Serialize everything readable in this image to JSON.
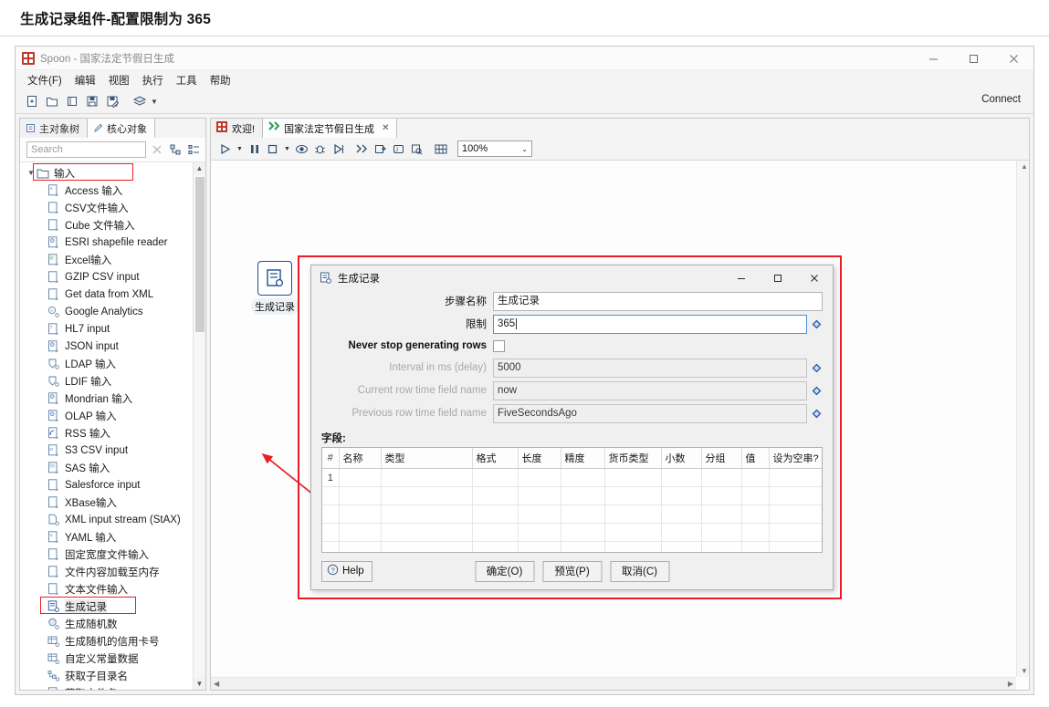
{
  "page": {
    "header_title": "生成记录组件-配置限制为 365"
  },
  "app": {
    "window_title": "Spoon - 国家法定节假日生成",
    "app_icon": "spoon-icon",
    "window_controls": [
      "minimize",
      "maximize",
      "close"
    ],
    "menus": [
      "文件(F)",
      "编辑",
      "视图",
      "执行",
      "工具",
      "帮助"
    ],
    "toolbar_icons": [
      "new-file-icon",
      "open-folder-icon",
      "explorer-icon",
      "save-icon",
      "save-as-icon",
      "layers-icon",
      "dropdown-caret-icon"
    ],
    "connect_label": "Connect"
  },
  "sidebar": {
    "tabs": [
      {
        "label": "主对象树",
        "icon": "tree-icon",
        "active": false
      },
      {
        "label": "核心对象",
        "icon": "pencil-icon",
        "active": true
      }
    ],
    "search": {
      "placeholder": "Search",
      "value": "",
      "clear_icon": "clear-x-icon",
      "expand_icon": "expand-all-icon",
      "collapse_icon": "collapse-all-icon"
    },
    "tree": {
      "root": {
        "label": "输入",
        "icon": "folder-icon",
        "expanded": true,
        "highlighted": true
      },
      "items": [
        {
          "label": "Access 输入",
          "icon": "access-input-icon"
        },
        {
          "label": "CSV文件输入",
          "icon": "csv-input-icon"
        },
        {
          "label": "Cube 文件输入",
          "icon": "cube-input-icon"
        },
        {
          "label": "ESRI shapefile reader",
          "icon": "esri-input-icon"
        },
        {
          "label": "Excel输入",
          "icon": "excel-input-icon"
        },
        {
          "label": "GZIP CSV input",
          "icon": "gzip-csv-icon"
        },
        {
          "label": "Get data from XML",
          "icon": "xml-input-icon"
        },
        {
          "label": "Google Analytics",
          "icon": "google-analytics-icon"
        },
        {
          "label": "HL7 input",
          "icon": "hl7-input-icon"
        },
        {
          "label": "JSON input",
          "icon": "json-input-icon"
        },
        {
          "label": "LDAP 输入",
          "icon": "ldap-input-icon"
        },
        {
          "label": "LDIF 输入",
          "icon": "ldif-input-icon"
        },
        {
          "label": "Mondrian 输入",
          "icon": "mondrian-input-icon"
        },
        {
          "label": "OLAP 输入",
          "icon": "olap-input-icon"
        },
        {
          "label": "RSS 输入",
          "icon": "rss-input-icon"
        },
        {
          "label": "S3 CSV input",
          "icon": "s3-csv-icon"
        },
        {
          "label": "SAS 输入",
          "icon": "sas-input-icon"
        },
        {
          "label": "Salesforce input",
          "icon": "salesforce-input-icon"
        },
        {
          "label": "XBase输入",
          "icon": "xbase-input-icon"
        },
        {
          "label": "XML input stream (StAX)",
          "icon": "stax-input-icon"
        },
        {
          "label": "YAML 输入",
          "icon": "yaml-input-icon"
        },
        {
          "label": "固定宽度文件输入",
          "icon": "fixed-width-icon"
        },
        {
          "label": "文件内容加载至内存",
          "icon": "load-file-icon"
        },
        {
          "label": "文本文件输入",
          "icon": "text-file-input-icon"
        },
        {
          "label": "生成记录",
          "icon": "generate-rows-icon",
          "highlighted": true
        },
        {
          "label": "生成随机数",
          "icon": "random-number-icon"
        },
        {
          "label": "生成随机的信用卡号",
          "icon": "random-cc-icon"
        },
        {
          "label": "自定义常量数据",
          "icon": "constant-data-icon"
        },
        {
          "label": "获取子目录名",
          "icon": "subdir-names-icon"
        },
        {
          "label": "获取文件名",
          "icon": "file-names-icon"
        }
      ]
    }
  },
  "canvas": {
    "tabs": [
      {
        "label": "欢迎!",
        "icon": "spoon-icon",
        "active": false,
        "closable": false
      },
      {
        "label": "国家法定节假日生成",
        "icon": "transformation-icon",
        "active": true,
        "closable": true,
        "close_glyph": "✕"
      }
    ],
    "toolbar_icons": [
      "run-icon",
      "run-dropdown-caret",
      "pause-icon",
      "stop-icon",
      "stop-dropdown-caret",
      "preview-icon",
      "debug-icon",
      "replay-icon",
      "verify-icon",
      "analyze-impact-icon",
      "sql-icon",
      "inspect-data-icon",
      "grid-icon"
    ],
    "zoom_level": "100%",
    "zoom_caret": "chevron-down-icon",
    "step": {
      "label": "生成记录",
      "icon": "generate-rows-icon"
    }
  },
  "dialog": {
    "title": "生成记录",
    "title_icon": "generate-rows-icon",
    "window_controls": [
      "minimize",
      "maximize",
      "close"
    ],
    "fields": [
      {
        "label": "步骤名称",
        "value": "生成记录",
        "disabled": false,
        "focused": false,
        "variable_icon": false
      },
      {
        "label": "限制",
        "value": "365",
        "disabled": false,
        "focused": true,
        "variable_icon": true
      },
      {
        "label": "Interval in ms (delay)",
        "value": "5000",
        "disabled": true,
        "focused": false,
        "variable_icon": true
      },
      {
        "label": "Current row time field name",
        "value": "now",
        "disabled": true,
        "focused": false,
        "variable_icon": true
      },
      {
        "label": "Previous row time field name",
        "value": "FiveSecondsAgo",
        "disabled": true,
        "focused": false,
        "variable_icon": true
      }
    ],
    "checkbox": {
      "label": "Never stop generating rows",
      "checked": false
    },
    "fields_section_label": "字段:",
    "table": {
      "columns": [
        "#",
        "名称",
        "类型",
        "格式",
        "长度",
        "精度",
        "货币类型",
        "小数",
        "分组",
        "值",
        "设为空串?",
        ""
      ],
      "rows": [
        {
          "num": "1",
          "cells": [
            "",
            "",
            "",
            "",
            "",
            "",
            "",
            "",
            "",
            "",
            ""
          ]
        }
      ]
    },
    "footer": {
      "help_label": "Help",
      "help_icon": "help-circle-icon",
      "buttons": [
        "确定(O)",
        "预览(P)",
        "取消(C)"
      ]
    }
  },
  "colors": {
    "highlight_red": "#ec1c24",
    "accent_blue": "#1c4f8f",
    "focus_border": "#4a90d9"
  }
}
